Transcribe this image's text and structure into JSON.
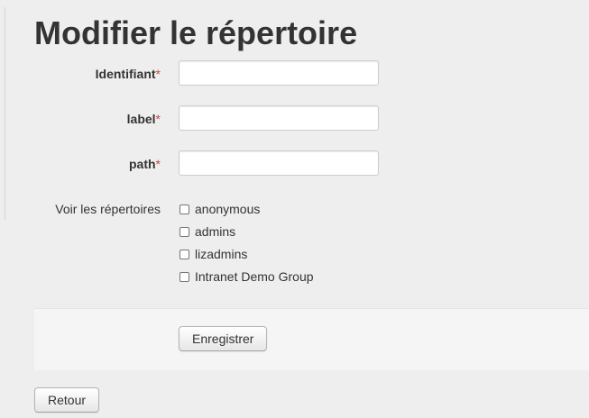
{
  "page": {
    "title": "Modifier le répertoire"
  },
  "form": {
    "fields": [
      {
        "label": "Identifiant",
        "required_mark": "*",
        "value": ""
      },
      {
        "label": "label",
        "required_mark": "*",
        "value": ""
      },
      {
        "label": "path",
        "required_mark": "*",
        "value": ""
      }
    ],
    "groups_label": "Voir les répertoires",
    "groups": [
      {
        "label": "anonymous",
        "checked": false
      },
      {
        "label": "admins",
        "checked": false
      },
      {
        "label": "lizadmins",
        "checked": false
      },
      {
        "label": "Intranet Demo Group",
        "checked": false
      }
    ],
    "submit_label": "Enregistrer"
  },
  "back_label": "Retour",
  "colors": {
    "required": "#b94a48",
    "background": "#eeeeee",
    "actions_bg": "#f5f5f5"
  }
}
